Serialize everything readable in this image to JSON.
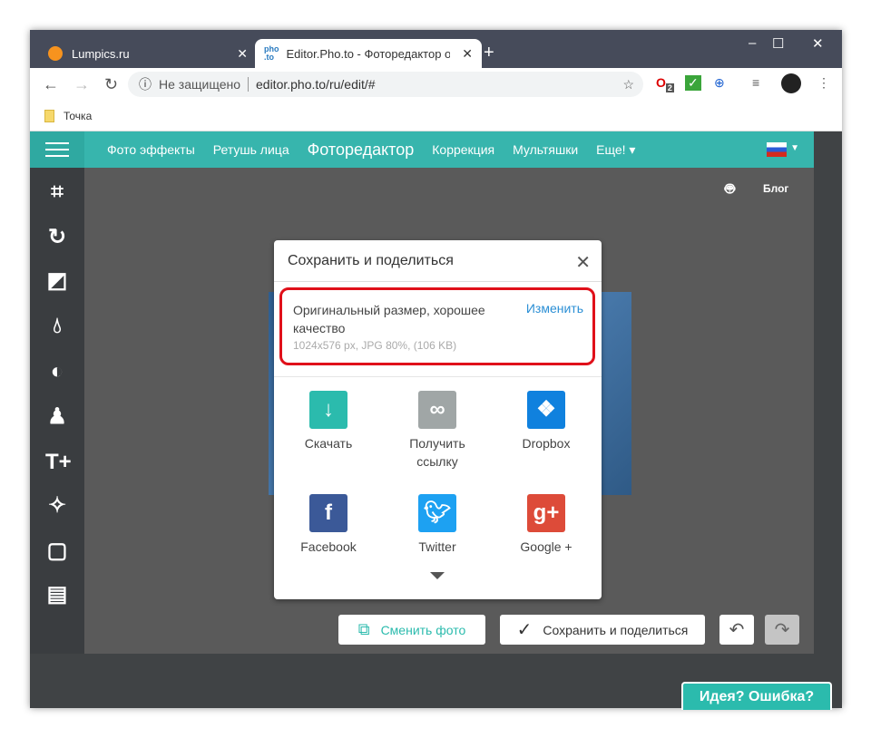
{
  "browser": {
    "tabs": [
      {
        "title": "Lumpics.ru"
      },
      {
        "title": "Editor.Pho.to - Фоторедактор он",
        "favicon": "pho\n.to"
      }
    ],
    "security": "Не защищено",
    "url": "editor.pho.to/ru/edit/#",
    "bookmark": "Точка",
    "ext_badge": "2"
  },
  "nav": {
    "items": [
      "Фото эффекты",
      "Ретушь лица",
      "Фоторедактор",
      "Коррекция",
      "Мультяшки",
      "Еще!"
    ],
    "active": "Фоторедактор"
  },
  "top_links": {
    "blog": "Блог"
  },
  "dialog": {
    "title": "Сохранить и поделиться",
    "quality": "Оригинальный размер, хорошее качество",
    "details": "1024x576 px, JPG 80%, (106 KB)",
    "change": "Изменить",
    "share": [
      {
        "label": "Скачать",
        "color": "#2bbbad"
      },
      {
        "label": "Получить ссылку",
        "color": "#a0a6a6"
      },
      {
        "label": "Dropbox",
        "color": "#1081de"
      },
      {
        "label": "Facebook",
        "color": "#3b5998"
      },
      {
        "label": "Twitter",
        "color": "#1da1f2"
      },
      {
        "label": "Google +",
        "color": "#dd4b39"
      }
    ]
  },
  "buttons": {
    "change_photo": "Сменить фото",
    "save_share": "Сохранить и поделиться"
  },
  "feedback": "Идея? Ошибка?"
}
